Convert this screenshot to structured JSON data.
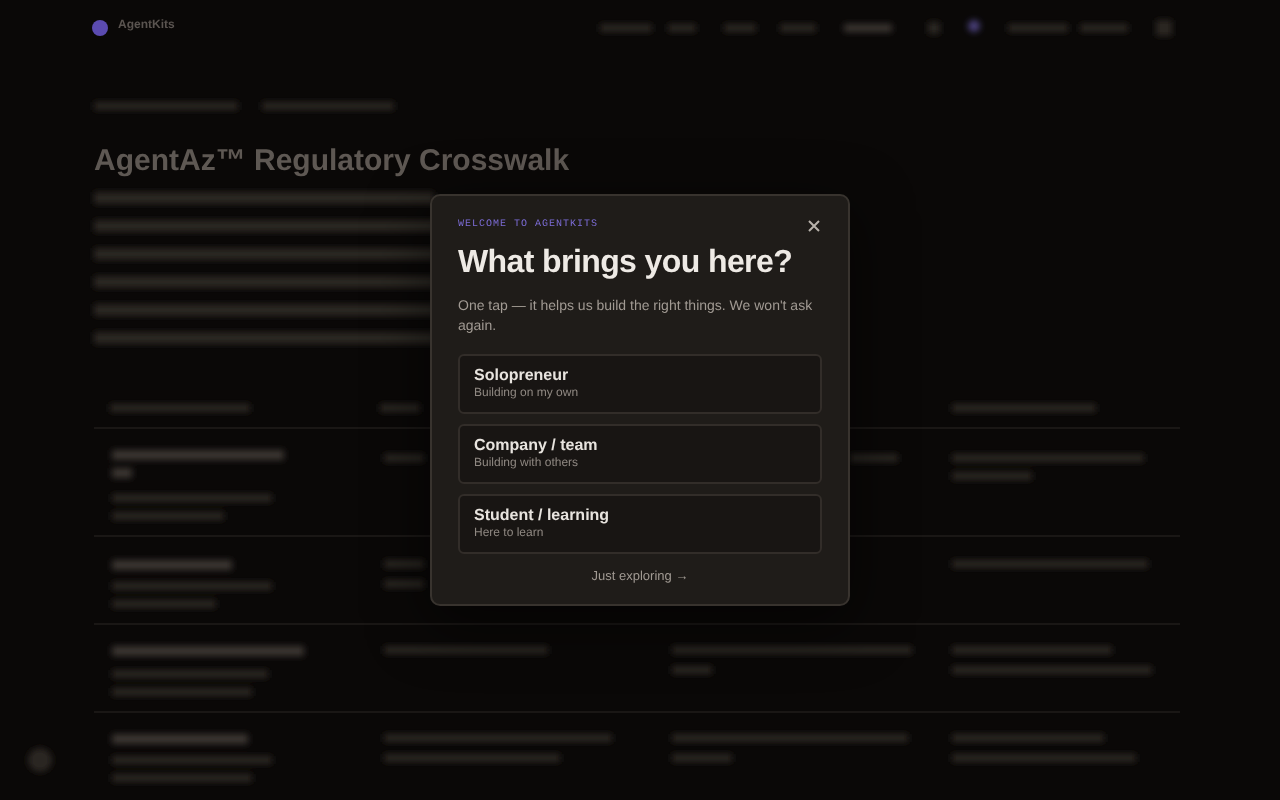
{
  "header": {
    "logo": "AgentKits"
  },
  "page": {
    "title": "AgentAz™ Regulatory Crosswalk"
  },
  "modal": {
    "eyebrow": "WELCOME TO AGENTKITS",
    "title": "What brings you here?",
    "subtitle": "One tap — it helps us build the right things. We won't ask again.",
    "options": [
      {
        "title": "Solopreneur",
        "subtitle": "Building on my own"
      },
      {
        "title": "Company / team",
        "subtitle": "Building with others"
      },
      {
        "title": "Student / learning",
        "subtitle": "Here to learn"
      }
    ],
    "skip": "Just exploring →"
  }
}
